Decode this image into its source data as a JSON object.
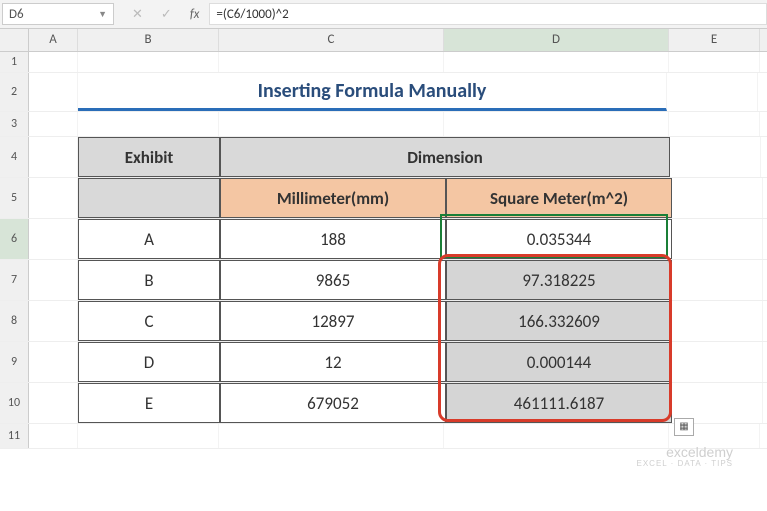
{
  "name_box": "D6",
  "formula": "=(C6/1000)^2",
  "columns": [
    "A",
    "B",
    "C",
    "D",
    "E"
  ],
  "selected_col": "D",
  "row_labels": [
    "1",
    "2",
    "3",
    "4",
    "5",
    "6",
    "7",
    "8",
    "9",
    "10",
    "11"
  ],
  "selected_row": "6",
  "title": "Inserting Formula Manually",
  "headers": {
    "exhibit": "Exhibit",
    "dimension": "Dimension",
    "mm": "Millimeter(mm)",
    "sq": "Square Meter(m^2)"
  },
  "rows": [
    {
      "exhibit": "A",
      "mm": "188",
      "sq": "0.035344"
    },
    {
      "exhibit": "B",
      "mm": "9865",
      "sq": "97.318225"
    },
    {
      "exhibit": "C",
      "mm": "12897",
      "sq": "166.332609"
    },
    {
      "exhibit": "D",
      "mm": "12",
      "sq": "0.000144"
    },
    {
      "exhibit": "E",
      "mm": "679052",
      "sq": "461111.6187"
    }
  ],
  "watermark": {
    "main": "exceldemy",
    "sub": "EXCEL · DATA · TIPS"
  },
  "chart_data": {
    "type": "table",
    "title": "Inserting Formula Manually",
    "columns": [
      "Exhibit",
      "Millimeter(mm)",
      "Square Meter(m^2)"
    ],
    "rows": [
      [
        "A",
        188,
        0.035344
      ],
      [
        "B",
        9865,
        97.318225
      ],
      [
        "C",
        12897,
        166.332609
      ],
      [
        "D",
        12,
        0.000144
      ],
      [
        "E",
        679052,
        461111.6187
      ]
    ],
    "formula_cell": "D6",
    "formula": "=(C6/1000)^2"
  }
}
